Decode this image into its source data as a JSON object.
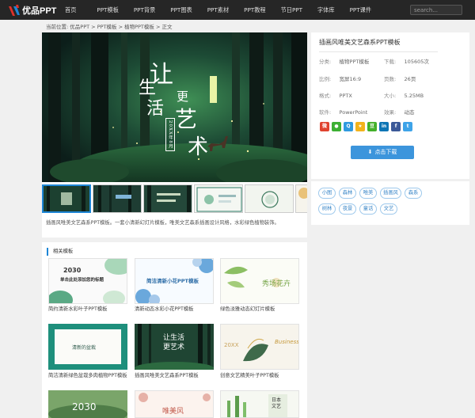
{
  "header": {
    "logo_text": "优品PPT",
    "nav": [
      "首页",
      "PPT模板",
      "PPT背景",
      "PPT图表",
      "PPT素材",
      "PPT教程",
      "节日PPT",
      "字体库",
      "PPT课件"
    ],
    "search_placeholder": "search..."
  },
  "breadcrumb": {
    "prefix": "当前位置:",
    "items": [
      "优品PPT",
      "PPT模板",
      "植物PPT模板",
      "正文"
    ],
    "sep": " > "
  },
  "hero": {
    "headline": [
      "让",
      "生",
      "活",
      "更",
      "艺",
      "术"
    ],
    "date_text": "20XX年8月"
  },
  "description": "插画风唯美文艺森系PPT模板。一套小清新幻灯片模板，唯美文艺森系插画设计风格，水彩绿色植物装饰。",
  "related": {
    "title": "相关模板",
    "items": [
      {
        "caption": "简约清新水彩叶子PPT模板",
        "title": "单击此处添加您的标题",
        "big": "2030"
      },
      {
        "caption": "清新动态水彩小花PPT模板",
        "title": "简洁清新小花PPT模板"
      },
      {
        "caption": "绿色淡雅动态幻灯片模板",
        "title": "秀场花卉"
      },
      {
        "caption": "简洁清新绿色盆栽多肉植物PPT模板",
        "title": "清新的盆栽"
      },
      {
        "caption": "插画风唯美文艺森系PPT模板",
        "title": "让生活更艺术"
      },
      {
        "caption": "创意文艺精美叶子PPT模板",
        "title": "Business",
        "sub": "20XX"
      },
      {
        "caption": "",
        "big": "2030"
      },
      {
        "caption": "",
        "title": "唯美风"
      },
      {
        "caption": "",
        "title": ""
      },
      {
        "caption": "",
        "title": "日本文艺"
      }
    ]
  },
  "sidebar": {
    "title": "插画风唯美文艺森系PPT模板",
    "meta": [
      {
        "k": "分类:",
        "v": "植物PPT模板"
      },
      {
        "k": "下载:",
        "v": "105605次"
      },
      {
        "k": "比例:",
        "v": "宽屏16:9"
      },
      {
        "k": "页数:",
        "v": "26页"
      },
      {
        "k": "格式:",
        "v": "PPTX"
      },
      {
        "k": "大小:",
        "v": "5.25MB"
      },
      {
        "k": "软件:",
        "v": "PowerPoint"
      },
      {
        "k": "效果:",
        "v": "动态"
      }
    ],
    "share_icons": [
      "weibo-icon",
      "wechat-icon",
      "qq-icon",
      "qzone-icon",
      "douban-icon",
      "linkedin-icon",
      "facebook-icon",
      "twitter-icon"
    ],
    "share_colors": [
      "#e0432f",
      "#3cb034",
      "#2f9ae0",
      "#f3b31c",
      "#43b02a",
      "#0d75b5",
      "#3b5998",
      "#3ea3e8"
    ],
    "download_label": "点击下载"
  },
  "tags": [
    "小图",
    "森林",
    "唯美",
    "插画风",
    "森系",
    "树林",
    "夜景",
    "童话",
    "文艺"
  ],
  "colors": {
    "accent": "#1e86d6",
    "button": "#3c95dc",
    "topbar": "#262626"
  }
}
